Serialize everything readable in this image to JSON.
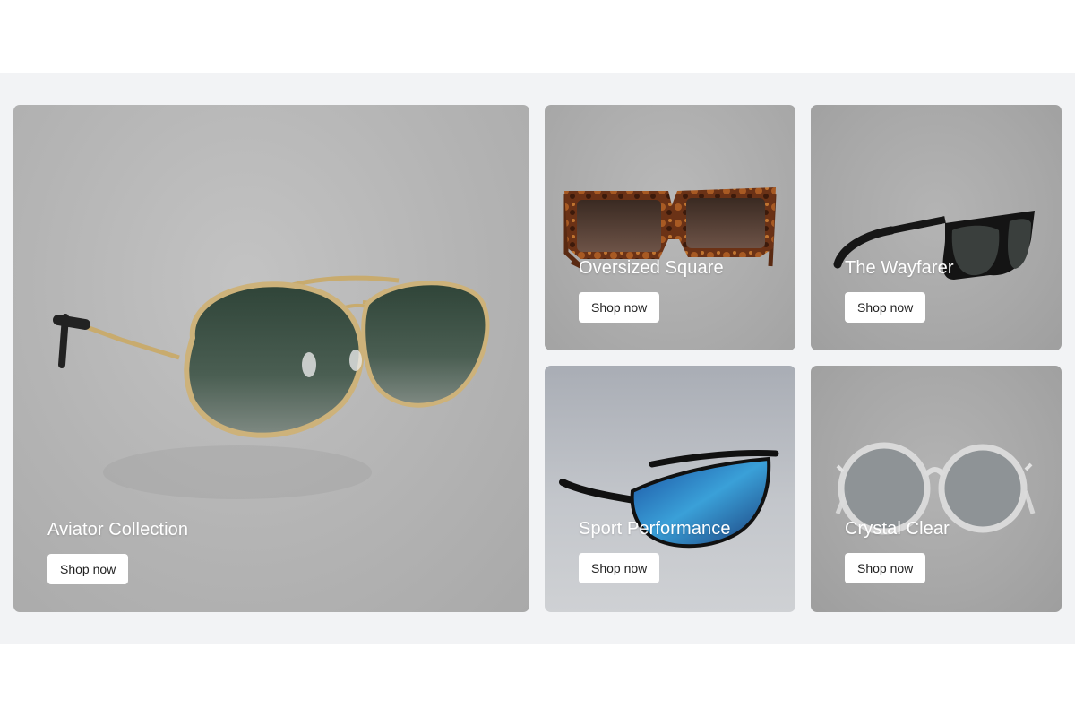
{
  "products": [
    {
      "title": "Aviator Collection",
      "cta": "Shop now"
    },
    {
      "title": "Oversized Square",
      "cta": "Shop now"
    },
    {
      "title": "The Wayfarer",
      "cta": "Shop now"
    },
    {
      "title": "Sport Performance",
      "cta": "Shop now"
    },
    {
      "title": "Crystal Clear",
      "cta": "Shop now"
    }
  ],
  "colors": {
    "band_background": "#f2f3f5",
    "title_text": "#ffffff",
    "button_background": "#ffffff",
    "button_text": "#222222"
  },
  "images": [
    {
      "icon": "aviator-sunglasses-image"
    },
    {
      "icon": "tortoiseshell-square-sunglasses-image"
    },
    {
      "icon": "black-wayfarer-sunglasses-image"
    },
    {
      "icon": "blue-mirror-sport-sunglasses-image"
    },
    {
      "icon": "clear-round-sunglasses-image"
    }
  ]
}
